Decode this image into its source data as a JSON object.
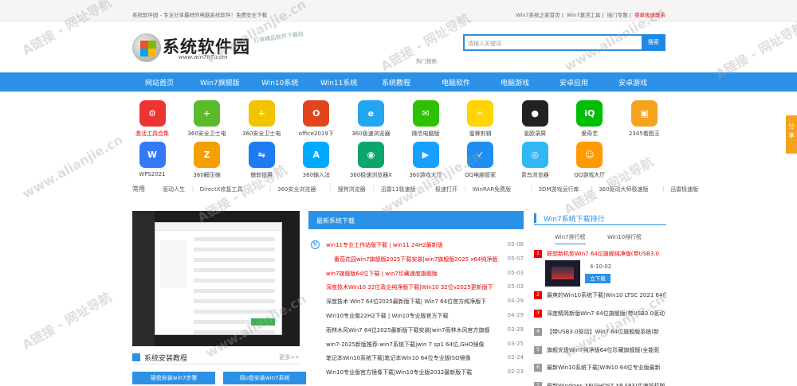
{
  "topbar": {
    "left_text": "系统软件园 - 专注分享最好的电脑系统软件！免费安全下载",
    "links": [
      "Win7系统之家首页",
      "Win7激活工具",
      "插门专题",
      "菜单极速联系"
    ]
  },
  "logo": {
    "title": "系统软件园",
    "url": "www.win7h7.com",
    "slogan": "打造精品软件下载站"
  },
  "search": {
    "placeholder": "请输入关键词",
    "button": "搜索",
    "hot": "热门搜索:"
  },
  "nav": [
    "网站首页",
    "Win7旗舰版",
    "Win10系统",
    "Win11系统",
    "系统教程",
    "电脑软件",
    "电脑游戏",
    "安卓应用",
    "安卓游戏"
  ],
  "apps_row1": [
    {
      "label": "激活工具合集",
      "icon": "activation-tool-icon",
      "color": "#e33"
    },
    {
      "label": "360安全卫士电",
      "icon": "360-security-icon",
      "color": "#5aba2a"
    },
    {
      "label": "360安全卫士电",
      "icon": "360-security-icon",
      "color": "#f2c400"
    },
    {
      "label": "office2019下",
      "icon": "office-icon",
      "color": "#e2441c"
    },
    {
      "label": "360极速浏览器",
      "icon": "360-browser-icon",
      "color": "#23a6f0"
    },
    {
      "label": "微信电脑版",
      "icon": "wechat-icon",
      "color": "#2dc100"
    },
    {
      "label": "蜜蜂剪辑",
      "icon": "bee-editor-icon",
      "color": "#ffd400"
    },
    {
      "label": "氢欧录屏",
      "icon": "screen-recorder-icon",
      "color": "#222"
    },
    {
      "label": "爱奇艺",
      "icon": "iqiyi-icon",
      "color": "#00be06"
    },
    {
      "label": "2345看图王",
      "icon": "2345-viewer-icon",
      "color": "#f6a31e"
    }
  ],
  "apps_row2": [
    {
      "label": "WPS2021",
      "icon": "wps-icon",
      "color": "#3478f6"
    },
    {
      "label": "360解压缩",
      "icon": "360-zip-icon",
      "color": "#f59f00"
    },
    {
      "label": "傲软投屏",
      "icon": "apowersoft-mirror-icon",
      "color": "#1e7cf0"
    },
    {
      "label": "360输入法",
      "icon": "360-input-icon",
      "color": "#00aaff"
    },
    {
      "label": "360极速浏览器X",
      "icon": "360-browser-x-icon",
      "color": "#0ba66b"
    },
    {
      "label": "360游戏大厅",
      "icon": "360-game-icon",
      "color": "#18a0ff"
    },
    {
      "label": "QQ电脑管家",
      "icon": "qq-manager-icon",
      "color": "#1d8ff3"
    },
    {
      "label": "青鸟浏览器",
      "icon": "qingniao-browser-icon",
      "color": "#32b7f5"
    },
    {
      "label": "QQ游戏大厅",
      "icon": "qq-game-icon",
      "color": "#ff9a00"
    }
  ],
  "common": {
    "label": "常用",
    "items": [
      "驱动人生",
      "DirectX修复工具",
      "360安全浏览器",
      "搜狗浏览器",
      "迅雷11极速版",
      "极速打开",
      "WinRAR免费版",
      "3DM游戏运行库",
      "360驱动大师极速版",
      "迅雷极速版"
    ]
  },
  "tutorial": {
    "title": "系统安装教程",
    "more": "更多>>",
    "btn1": "硬盘安装win7步骤",
    "btn2": "用u盘安装win7系统"
  },
  "news": {
    "title": "最新系统下载",
    "items": [
      {
        "text": "win11专业工作站版下载 | win11 24H2最新版",
        "date": "05-08",
        "red": true,
        "icon": true
      },
      {
        "text": "番茄花园win7旗舰版2025下载安装|win7旗舰版2025 x64纯净版",
        "date": "05-07",
        "red": true,
        "indent": true
      },
      {
        "text": "win7旗舰版64位下载 | win7珍藏速度旗舰版",
        "date": "05-03",
        "red": true
      },
      {
        "text": "深度技术Win10 32位政企纯净版下载|Win10 32位v2025更新版下",
        "date": "05-03",
        "red": true
      },
      {
        "text": "深度技术 Win7 64位2025最新版下载| Win7 64位官方纯净版下",
        "date": "04-29",
        "red": false
      },
      {
        "text": "Win10专业版22H2下载 | Win10专业版官方下载",
        "date": "04-29",
        "red": false
      },
      {
        "text": "雨林木风Win7 64位2025最新版下载安装|win7雨林木风官方旗舰",
        "date": "03-29",
        "red": false
      },
      {
        "text": "win7-2025新版推荐-win7系统下载|win 7 sp1 64位,GHO镜像",
        "date": "03-25",
        "red": false
      },
      {
        "text": "笔记本Win10系统下载|笔记本Win10 64位专业版ISO镜像",
        "date": "03-24",
        "red": false
      },
      {
        "text": "Win10专业版官方镜像下载|Win10专业版2032最新版下载",
        "date": "02-23",
        "red": false
      }
    ]
  },
  "rank": {
    "title": "Win7系统下载排行",
    "tabs": [
      "Win7排行榜",
      "Win10排行榜"
    ],
    "items": [
      {
        "n": "1",
        "text": "联想新机型Win7 64位旗舰纯净版(带USB3.0",
        "red": true
      },
      {
        "n": "2",
        "text": "最爽的Win10系统下载|Win10 LTSC 2021 64位企",
        "red": false
      },
      {
        "n": "3",
        "text": "深度精简新版Win7 64位旗舰版(带USB3.0驱动",
        "red": false
      },
      {
        "n": "4",
        "text": "【带USB3.0驱动】Win7 64位旗舰版系统(新",
        "red": false
      },
      {
        "n": "5",
        "text": "旗舰优盘Win7纯净版64位珍藏旗舰版(全能驱",
        "red": false
      },
      {
        "n": "6",
        "text": "最新Win10系统下载|WIN10 64位专业版最新",
        "red": false
      },
      {
        "n": "7",
        "text": "最新Windows XP(GHOST XP SP3)实速装机版",
        "red": false
      }
    ],
    "feature": {
      "date": "4-10-02",
      "button": "立下载"
    }
  },
  "share": "分享",
  "watermark": [
    "A链接 - 网址导航",
    "www.alianjie.cn"
  ]
}
